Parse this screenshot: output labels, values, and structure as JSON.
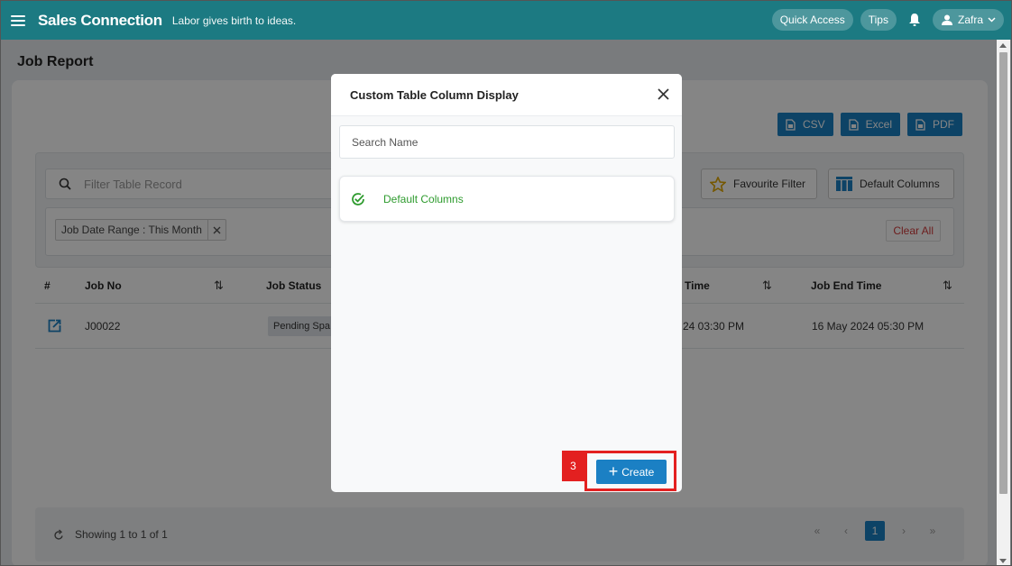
{
  "topbar": {
    "brand": "Sales Connection",
    "tagline": "Labor gives birth to ideas.",
    "quick_access": "Quick Access",
    "tips": "Tips",
    "user_name": "Zafra"
  },
  "page": {
    "title": "Job Report",
    "exports": {
      "csv": "CSV",
      "excel": "Excel",
      "pdf": "PDF"
    },
    "filter_placeholder": "Filter Table Record",
    "favourite_filter": "Favourite Filter",
    "default_columns": "Default Columns",
    "chip_label": "Job Date Range : This Month",
    "clear_all": "Clear All",
    "table": {
      "headers": [
        "#",
        "Job No",
        "Job Status",
        "Time",
        "Job End Time"
      ],
      "rows": [
        {
          "job_no": "J00022",
          "status": "Pending Spa",
          "start_time": "24 03:30 PM",
          "end_time": "16 May 2024 05:30 PM"
        }
      ]
    },
    "showing": "Showing 1 to 1 of 1",
    "pager": {
      "first": "«",
      "prev": "‹",
      "current": "1",
      "next": "›",
      "last": "»"
    }
  },
  "modal": {
    "title": "Custom Table Column Display",
    "search_placeholder": "Search Name",
    "items": [
      {
        "label": "Default Columns"
      }
    ],
    "create_label": "Create"
  },
  "annotation": {
    "step": "3"
  },
  "colors": {
    "topbar": "#1c7a82",
    "primary": "#1b80c4",
    "highlight": "#e32020",
    "success": "#2e9b2e"
  }
}
